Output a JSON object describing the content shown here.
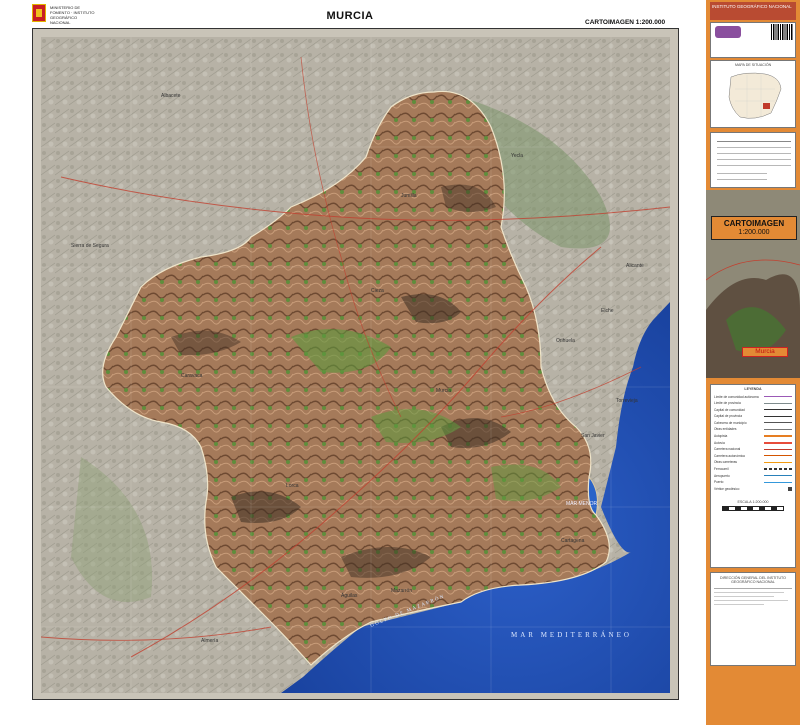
{
  "header": {
    "logo_text": "MINISTERIO DE FOMENTO · INSTITUTO GEOGRÁFICO NACIONAL",
    "title": "MURCIA",
    "scale_title": "CARTOIMAGEN 1:200.000"
  },
  "map": {
    "sea_label": "MAR MEDITERRÁNEO",
    "gulf_label": "GOLFO DE MAZARRÓN",
    "mar_menor_label": "MAR MENOR",
    "places": [
      "Murcia",
      "Cartagena",
      "Lorca",
      "Caravaca",
      "Jumilla",
      "Yecla",
      "Cieza",
      "Alicante",
      "Torrevieja",
      "Águilas",
      "Mazarrón",
      "Almería",
      "Sierra de Segura",
      "Albacete",
      "Elche",
      "Orihuela",
      "San Javier"
    ],
    "colors": {
      "sea": "#1f4fb8",
      "land_outside": "#b9b6ad",
      "region": "#9a7456",
      "green": "#5a8f3a",
      "road": "#c2402f"
    }
  },
  "sidebar": {
    "ign_title": "INSTITUTO GEOGRÁFICO NACIONAL",
    "cover_title": "CARTOIMAGEN",
    "cover_scale": "1:200.000",
    "cover_name": "Murcia",
    "legend_title": "LEYENDA",
    "legend_items": [
      "Límite de comunidad autónoma",
      "Límite de provincia",
      "Capital de comunidad",
      "Capital de provincia",
      "Cabecera de municipio",
      "Otras entidades",
      "Autopista",
      "Autovía",
      "Carretera nacional",
      "Carretera autonómica",
      "Otras carreteras",
      "Ferrocarril",
      "Aeropuerto",
      "Puerto",
      "Vértice geodésico"
    ],
    "legend_scale": "ESCALA 1:200.000",
    "location_title": "MAPA DE SITUACIÓN",
    "credits_title": "DIRECCIÓN GENERAL DEL INSTITUTO GEOGRÁFICO NACIONAL",
    "colors": {
      "sidebar": "#e38a35",
      "ign_red": "#b94b32"
    }
  }
}
